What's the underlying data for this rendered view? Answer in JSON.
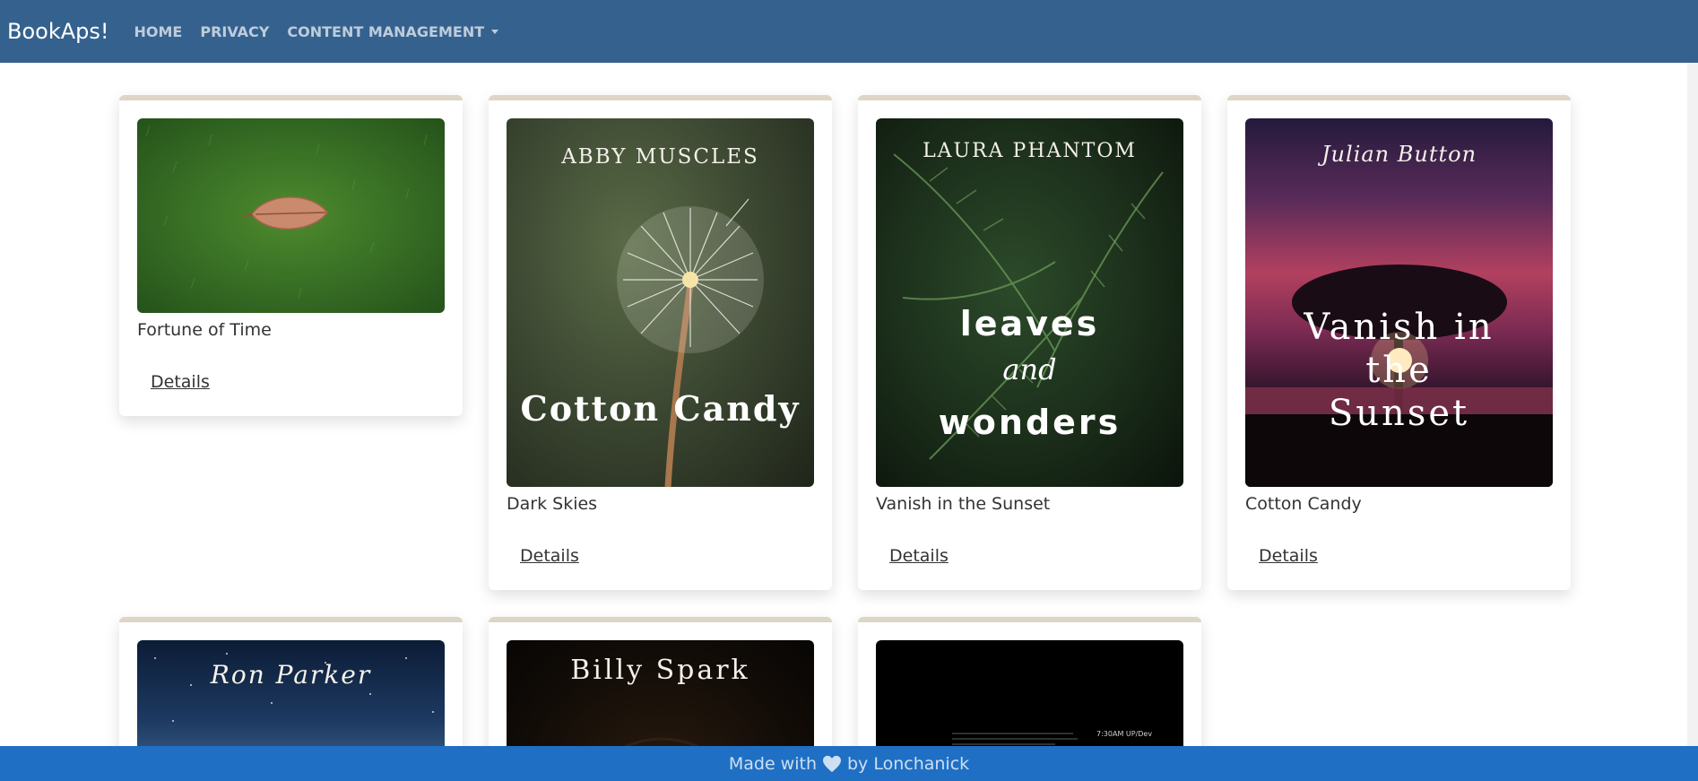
{
  "nav": {
    "brand": "BookAps!",
    "home": "HOME",
    "privacy": "PRIVACY",
    "content_management": "CONTENT MANAGEMENT"
  },
  "books": [
    {
      "title": "Fortune of Time",
      "details": "Details",
      "cover_author": "",
      "cover_title": ""
    },
    {
      "title": "Dark Skies",
      "details": "Details",
      "cover_author": "ABBY MUSCLES",
      "cover_title": "Cotton Candy"
    },
    {
      "title": "Vanish in the Sunset",
      "details": "Details",
      "cover_author": "LAURA PHANTOM",
      "cover_title_1": "leaves",
      "cover_title_2": "and",
      "cover_title_3": "wonders"
    },
    {
      "title": "Cotton Candy",
      "details": "Details",
      "cover_author": "Julian Button",
      "cover_title_1": "Vanish in",
      "cover_title_2": "the",
      "cover_title_3": "Sunset"
    },
    {
      "cover_author": "Ron Parker"
    },
    {
      "cover_author": "Billy Spark"
    },
    {
      "cover_time": "7:30AM UP/Dev"
    }
  ],
  "footer": {
    "made_with": "Made with",
    "by": "by Lonchanick"
  },
  "colors": {
    "navbar": "#35618e",
    "footer": "#1f6fc4",
    "card_top_border": "#ddd6c6"
  }
}
